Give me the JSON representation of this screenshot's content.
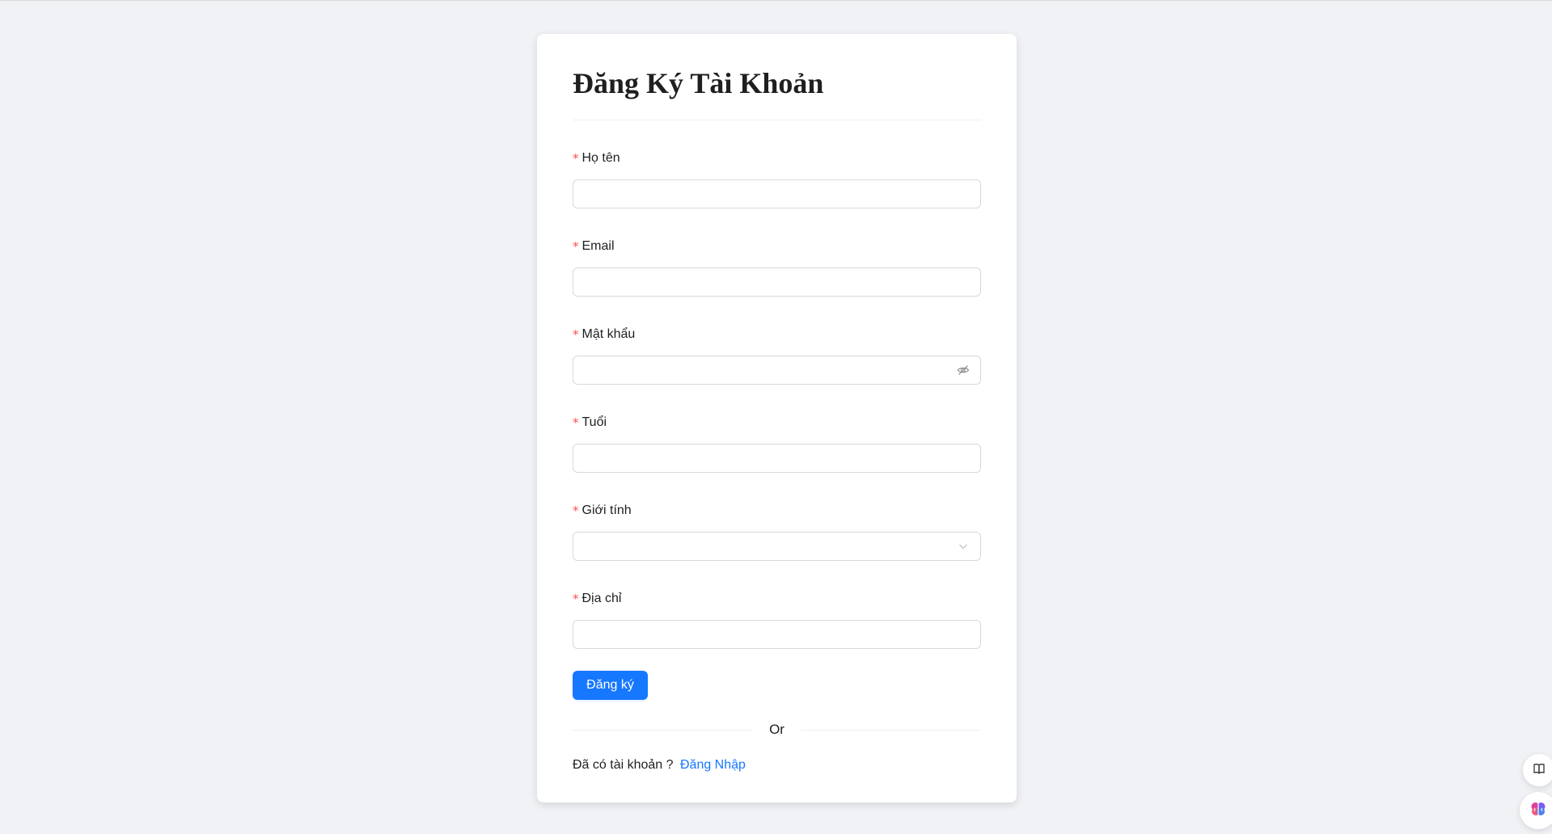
{
  "page": {
    "title": "Đăng Ký Tài Khoản"
  },
  "form": {
    "required_mark": "*",
    "fields": [
      {
        "label": "Họ tên",
        "value": "",
        "placeholder": ""
      },
      {
        "label": "Email",
        "value": "",
        "placeholder": ""
      },
      {
        "label": "Mật khẩu",
        "value": "",
        "placeholder": "",
        "suffix_icon": "eye-invisible-icon"
      },
      {
        "label": "Tuổi",
        "value": "",
        "placeholder": ""
      },
      {
        "label": "Giới tính",
        "value": "",
        "placeholder": "",
        "suffix_icon": "chevron-down-icon"
      },
      {
        "label": "Địa chỉ",
        "value": "",
        "placeholder": ""
      }
    ],
    "submit_label": "Đăng ký",
    "divider_text": "Or",
    "login_prompt": "Đã có tài khoản ?",
    "login_link": "Đăng Nhập"
  },
  "floating": {
    "book_icon": "book-icon",
    "brain_icon": "brain-icon"
  },
  "colors": {
    "primary": "#1677ff",
    "required": "#ff4d4f",
    "background": "#f0f2f5",
    "card": "#ffffff"
  }
}
